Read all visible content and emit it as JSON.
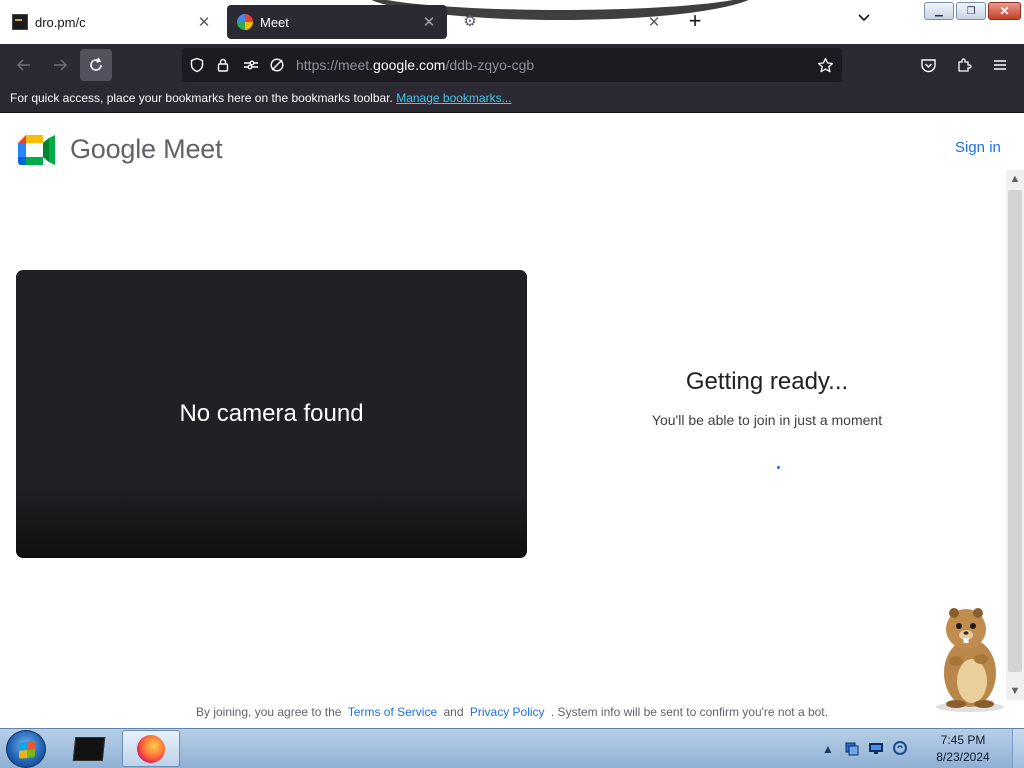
{
  "browser": {
    "tabs": [
      {
        "label": "dro.pm/c",
        "favicon": "terminal-favicon",
        "active": false
      },
      {
        "label": "Meet",
        "favicon": "google-meet-favicon",
        "active": true
      },
      {
        "label": "",
        "favicon": "gear-favicon",
        "active": false
      }
    ],
    "url": {
      "prefix": "https://meet.",
      "host": "google.com",
      "path": "/ddb-zqyo-cgb"
    },
    "bookmarks_bar": {
      "message": "For quick access, place your bookmarks here on the bookmarks toolbar.",
      "manage_link": "Manage bookmarks..."
    }
  },
  "page": {
    "brand": "Google Meet",
    "sign_in": "Sign in",
    "video_message": "No camera found",
    "status_title": "Getting ready...",
    "status_subtitle": "You'll be able to join in just a moment",
    "legal": {
      "prefix": "By joining, you agree to the",
      "terms": "Terms of Service",
      "and": "and",
      "privacy": "Privacy Policy",
      "suffix": ". System info will be sent to confirm you're not a bot."
    }
  },
  "taskbar": {
    "clock_time": "7:45 PM",
    "clock_date": "8/23/2024"
  },
  "colors": {
    "accent": "#1a73e8",
    "browser_chrome": "#2b2a33",
    "video_bg": "#202124"
  }
}
